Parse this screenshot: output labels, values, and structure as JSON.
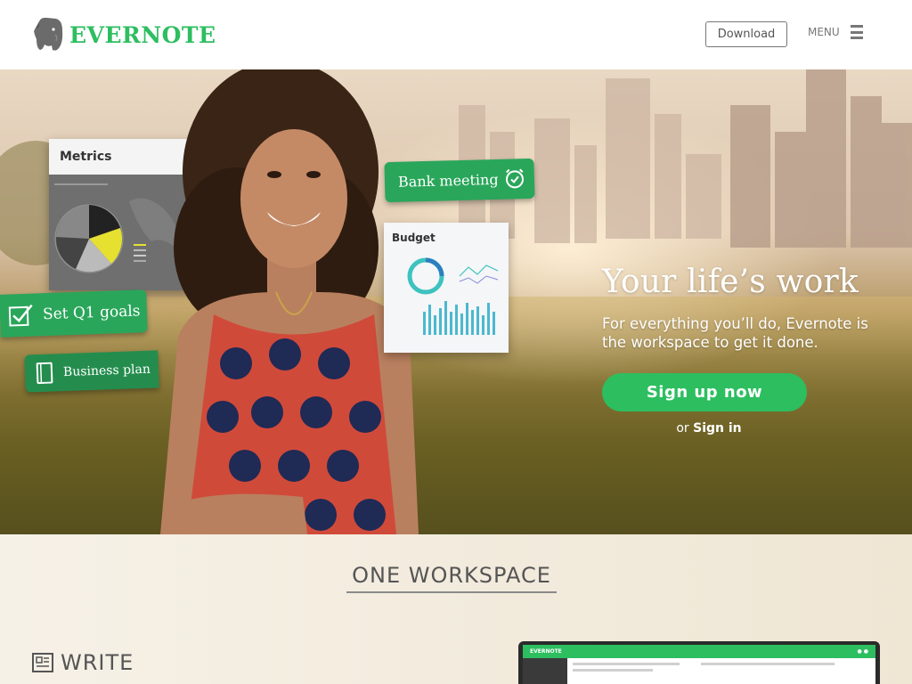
{
  "header": {
    "logo_text": "EVERNOTE",
    "download_label": "Download",
    "menu_label": "MENU"
  },
  "hero": {
    "title": "Your life’s work",
    "subtitle": "For everything you’ll do, Evernote is the workspace to get it done.",
    "signup_label": "Sign up now",
    "signin_prefix": "or",
    "signin_label": "Sign in",
    "cards": {
      "metrics_title": "Metrics",
      "budget_title": "Budget",
      "bank_meeting": "Bank meeting",
      "set_q1_goals": "Set Q1 goals",
      "business_plan": "Business plan"
    }
  },
  "section": {
    "title": "ONE WORKSPACE",
    "write_label": "WRITE",
    "app_name": "EVERNOTE"
  },
  "colors": {
    "brand_green": "#2dbe60",
    "tag_green": "#2aa65a",
    "text_gray": "#555555"
  },
  "icons": {
    "logo": "elephant-logo-icon",
    "menu": "hamburger-menu-icon",
    "bank": "alarm-clock-icon",
    "q1": "checkbox-icon",
    "biz": "notebook-icon",
    "write": "note-document-icon"
  }
}
